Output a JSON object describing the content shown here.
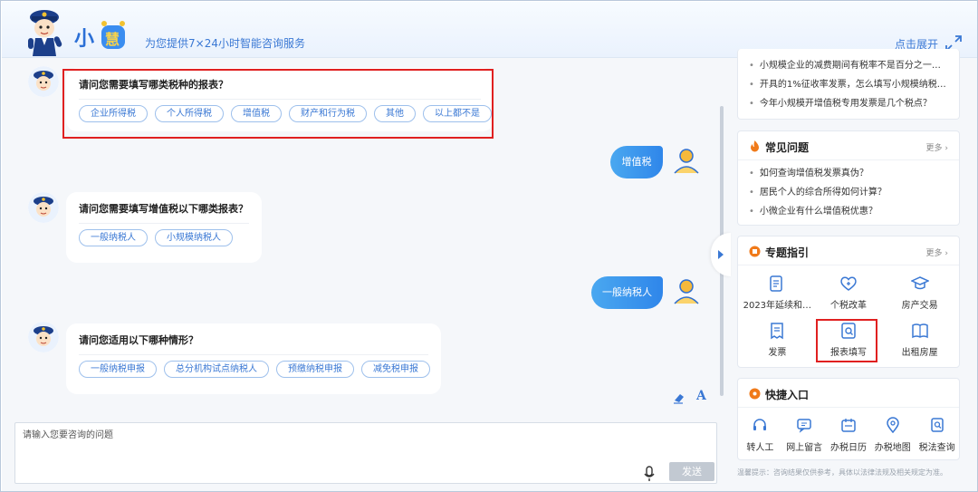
{
  "header": {
    "brand_char1": "小",
    "brand_char2": "慧",
    "tagline": "为您提供7×24小时智能咨询服务",
    "expand_label": "点击展开"
  },
  "chat": {
    "messages": [
      {
        "question": "请问您需要填写哪类税种的报表？",
        "options": [
          "企业所得税",
          "个人所得税",
          "增值税",
          "财产和行为税",
          "其他",
          "以上都不是"
        ]
      },
      {
        "user_reply": "增值税"
      },
      {
        "question": "请问您需要填写增值税以下哪类报表？",
        "options": [
          "一般纳税人",
          "小规模纳税人"
        ]
      },
      {
        "user_reply": "一般纳税人"
      },
      {
        "question": "请问您适用以下哪种情形？",
        "options": [
          "一般纳税申报",
          "总分机构试点纳税人",
          "预缴纳税申报",
          "减免税申报"
        ]
      }
    ],
    "font_icon_text": "A"
  },
  "input": {
    "placeholder": "请输入您要咨询的问题",
    "send_label": "发送"
  },
  "right_panel": {
    "top_list": [
      "小规模企业的减费期间有税率不是百分之一吗…",
      "开具的1%征收率发票，怎么填写小规模纳税…",
      "今年小规模开增值税专用发票是几个税点？"
    ],
    "faq": {
      "title": "常见问题",
      "more": "更多",
      "items": [
        "如何查询增值税发票真伪？",
        "居民个人的综合所得如何计算？",
        "小微企业有什么增值税优惠？"
      ]
    },
    "topics": {
      "title": "专题指引",
      "more": "更多",
      "items": [
        {
          "label": "2023年延续和…",
          "icon": "document-icon"
        },
        {
          "label": "个税改革",
          "icon": "heart-plus-icon"
        },
        {
          "label": "房产交易",
          "icon": "graduation-cap-icon"
        },
        {
          "label": "发票",
          "icon": "invoice-icon"
        },
        {
          "label": "报表填写",
          "icon": "report-search-icon"
        },
        {
          "label": "出租房屋",
          "icon": "book-icon"
        }
      ]
    },
    "quick": {
      "title": "快捷入口",
      "items": [
        {
          "label": "转人工",
          "icon": "headset-icon"
        },
        {
          "label": "网上留言",
          "icon": "message-icon"
        },
        {
          "label": "办税日历",
          "icon": "calendar-icon"
        },
        {
          "label": "办税地图",
          "icon": "map-pin-icon"
        },
        {
          "label": "税法查询",
          "icon": "search-doc-icon"
        }
      ]
    },
    "tip": "温馨提示：咨询结果仅供参考，具体以法律法规及相关规定为准。"
  },
  "colors": {
    "accent": "#3a78d4",
    "chip_border": "#9ec0ec",
    "highlight": "#e02020",
    "user_bubble": "#2f86ea",
    "orange": "#f07a1a"
  }
}
